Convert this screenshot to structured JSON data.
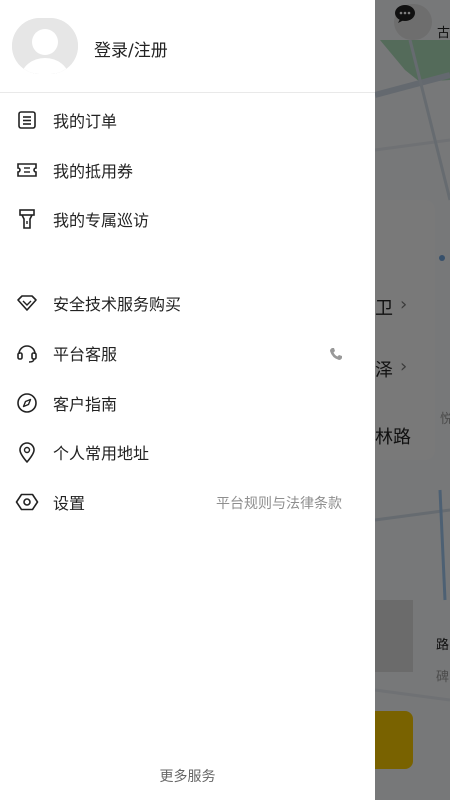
{
  "map": {
    "labels": [
      "古",
      "卫",
      "泽",
      "林路",
      "悦",
      "路",
      "碑"
    ]
  },
  "profile": {
    "login_label": "登录/注册"
  },
  "menu": {
    "group1": [
      {
        "label": "我的订单",
        "icon": "order-list-icon"
      },
      {
        "label": "我的抵用券",
        "icon": "coupon-icon"
      },
      {
        "label": "我的专属巡访",
        "icon": "flashlight-icon"
      }
    ],
    "group2": [
      {
        "label": "安全技术服务购买",
        "icon": "diamond-icon"
      },
      {
        "label": "平台客服",
        "icon": "headset-icon"
      },
      {
        "label": "客户指南",
        "icon": "compass-icon"
      },
      {
        "label": "个人常用地址",
        "icon": "location-pin-icon"
      },
      {
        "label": "设置",
        "icon": "eye-settings-icon"
      }
    ]
  },
  "links": {
    "policy": "平台规则与法律条款",
    "more_services": "更多服务"
  },
  "colors": {
    "accent_yellow": "#f3c400",
    "text_primary": "#222222",
    "text_secondary": "#8e8e8e"
  }
}
